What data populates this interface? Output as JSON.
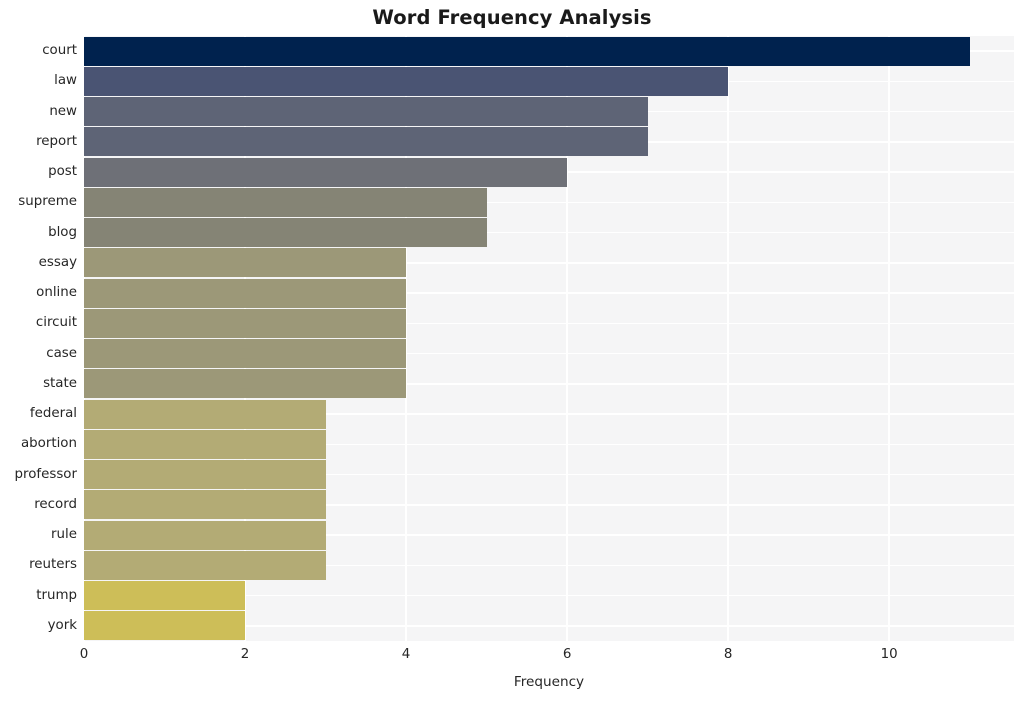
{
  "chart_data": {
    "type": "bar",
    "orientation": "horizontal",
    "title": "Word Frequency Analysis",
    "xlabel": "Frequency",
    "ylabel": "",
    "xlim": [
      0,
      11.55
    ],
    "ylim": null,
    "grid": true,
    "legend": null,
    "xticks": [
      0,
      2,
      4,
      6,
      8,
      10
    ],
    "xtick_labels": [
      "0",
      "2",
      "4",
      "6",
      "8",
      "10"
    ],
    "categories": [
      "court",
      "law",
      "new",
      "report",
      "post",
      "supreme",
      "blog",
      "essay",
      "online",
      "circuit",
      "case",
      "state",
      "federal",
      "abortion",
      "professor",
      "record",
      "rule",
      "reuters",
      "trump",
      "york"
    ],
    "values": [
      11,
      8,
      7,
      7,
      6,
      5,
      5,
      4,
      4,
      4,
      4,
      4,
      3,
      3,
      3,
      3,
      3,
      3,
      2,
      2
    ],
    "bar_colors": [
      "#00224e",
      "#4a5473",
      "#5e6476",
      "#5e6476",
      "#6e7077",
      "#858475",
      "#858475",
      "#9c9878",
      "#9c9878",
      "#9c9878",
      "#9c9878",
      "#9c9878",
      "#b3ab75",
      "#b3ab75",
      "#b3ab75",
      "#b3ab75",
      "#b3ab75",
      "#b3ab75",
      "#cdbe58",
      "#cdbe58"
    ],
    "colormap": "cividis",
    "plot_bg": "#f5f5f6",
    "grid_color": "#ffffff",
    "text_color": "#262626",
    "figure_bg": "#ffffff"
  }
}
